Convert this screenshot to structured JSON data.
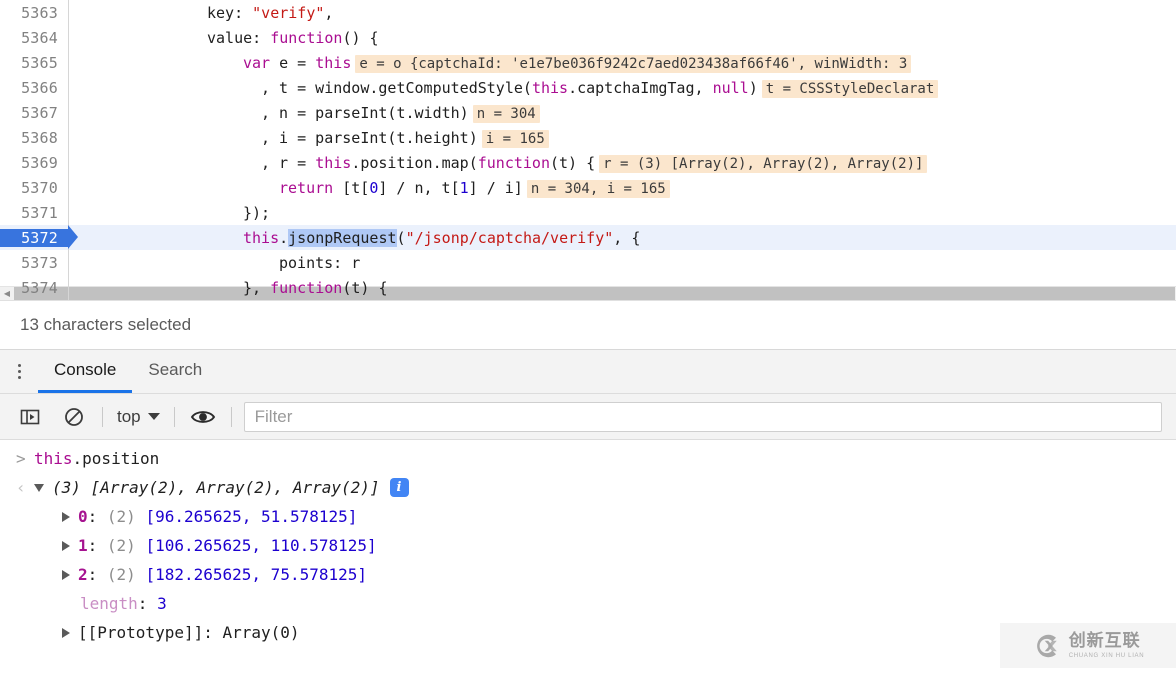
{
  "editor": {
    "lines": [
      {
        "num": "5363",
        "indent": 13,
        "tokens": [
          {
            "t": "key: ",
            "c": "plain"
          },
          {
            "t": "\"verify\"",
            "c": "str"
          },
          {
            "t": ",",
            "c": "plain"
          }
        ],
        "hint": ""
      },
      {
        "num": "5364",
        "indent": 13,
        "tokens": [
          {
            "t": "value: ",
            "c": "plain"
          },
          {
            "t": "function",
            "c": "mag"
          },
          {
            "t": "() {",
            "c": "plain"
          }
        ],
        "hint": ""
      },
      {
        "num": "5365",
        "indent": 17,
        "tokens": [
          {
            "t": "var",
            "c": "mag"
          },
          {
            "t": " e = ",
            "c": "plain"
          },
          {
            "t": "this",
            "c": "mag"
          }
        ],
        "hint": "e = o {captchaId: 'e1e7be036f9242c7aed023438af66f46', winWidth: 3"
      },
      {
        "num": "5366",
        "indent": 19,
        "tokens": [
          {
            "t": ", t = window.getComputedStyle(",
            "c": "plain"
          },
          {
            "t": "this",
            "c": "mag"
          },
          {
            "t": ".captchaImgTag, ",
            "c": "plain"
          },
          {
            "t": "null",
            "c": "mag"
          },
          {
            "t": ")",
            "c": "plain"
          }
        ],
        "hint": "t = CSSStyleDeclarat"
      },
      {
        "num": "5367",
        "indent": 19,
        "tokens": [
          {
            "t": ", n = parseInt(t.width)",
            "c": "plain"
          }
        ],
        "hint": "n = 304"
      },
      {
        "num": "5368",
        "indent": 19,
        "tokens": [
          {
            "t": ", i = parseInt(t.height)",
            "c": "plain"
          }
        ],
        "hint": "i = 165"
      },
      {
        "num": "5369",
        "indent": 19,
        "tokens": [
          {
            "t": ", r = ",
            "c": "plain"
          },
          {
            "t": "this",
            "c": "mag"
          },
          {
            "t": ".position.map(",
            "c": "plain"
          },
          {
            "t": "function",
            "c": "mag"
          },
          {
            "t": "(t) {",
            "c": "plain"
          }
        ],
        "hint": "r = (3) [Array(2), Array(2), Array(2)]"
      },
      {
        "num": "5370",
        "indent": 21,
        "tokens": [
          {
            "t": "return",
            "c": "mag"
          },
          {
            "t": " [t[",
            "c": "plain"
          },
          {
            "t": "0",
            "c": "num"
          },
          {
            "t": "] / n, t[",
            "c": "plain"
          },
          {
            "t": "1",
            "c": "num"
          },
          {
            "t": "] / i]",
            "c": "plain"
          }
        ],
        "hint": "n = 304, i = 165"
      },
      {
        "num": "5371",
        "indent": 17,
        "tokens": [
          {
            "t": "});",
            "c": "plain"
          }
        ],
        "hint": ""
      },
      {
        "num": "5372",
        "indent": 17,
        "active": true,
        "tokens": [
          {
            "t": "this",
            "c": "mag"
          },
          {
            "t": ".",
            "c": "plain"
          },
          {
            "t": "jsonpRequest",
            "c": "sel"
          },
          {
            "t": "(",
            "c": "plain"
          },
          {
            "t": "\"/jsonp/captcha/verify\"",
            "c": "str"
          },
          {
            "t": ", {",
            "c": "plain"
          }
        ],
        "hint": ""
      },
      {
        "num": "5373",
        "indent": 21,
        "tokens": [
          {
            "t": "points: r",
            "c": "plain"
          }
        ],
        "hint": ""
      },
      {
        "num": "5374",
        "indent": 17,
        "tokens": [
          {
            "t": "}, ",
            "c": "plain"
          },
          {
            "t": "function",
            "c": "mag"
          },
          {
            "t": "(t) {",
            "c": "plain"
          }
        ],
        "hint": ""
      }
    ],
    "scrollbar": {
      "left_arrow": "◀"
    }
  },
  "statusbar": {
    "text": "13 characters selected"
  },
  "drawer": {
    "menu_icon": "kebab-menu-icon",
    "tabs": [
      {
        "label": "Console",
        "active": true
      },
      {
        "label": "Search",
        "active": false
      }
    ]
  },
  "console_toolbar": {
    "sidebar_toggle_icon": "console-sidebar-toggle-icon",
    "clear_icon": "clear-console-icon",
    "context_label": "top",
    "eye_icon": "live-expression-eye-icon",
    "filter_placeholder": "Filter"
  },
  "console": {
    "prompt_arrow": ">",
    "input_tokens": [
      {
        "t": "this",
        "c": "mag"
      },
      {
        "t": ".position",
        "c": "dark"
      }
    ],
    "return_arrow": "‹",
    "result_summary": {
      "count": "(3)",
      "preview": "[Array(2), Array(2), Array(2)]",
      "info_icon": "i"
    },
    "properties": [
      {
        "key": "0",
        "count": "(2)",
        "value": "[96.265625, 51.578125]",
        "expandable": true
      },
      {
        "key": "1",
        "count": "(2)",
        "value": "[106.265625, 110.578125]",
        "expandable": true
      },
      {
        "key": "2",
        "count": "(2)",
        "value": "[182.265625, 75.578125]",
        "expandable": true
      }
    ],
    "length_key": "length",
    "length_value": "3",
    "prototype_key": "[[Prototype]]",
    "prototype_value": "Array(0)"
  },
  "watermark": {
    "cn": "创新互联",
    "pinyin": "CHUANG XIN HU LIAN",
    "mark_letter": "CX"
  }
}
